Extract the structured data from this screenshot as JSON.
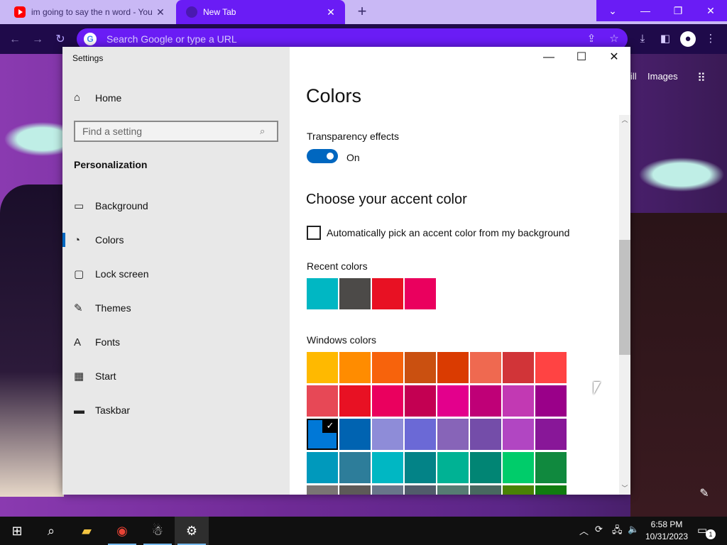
{
  "browser": {
    "tabs": [
      {
        "title": "im going to say the n word - You",
        "close": "✕"
      },
      {
        "title": "New Tab",
        "close": "✕"
      }
    ],
    "new_tab": "+",
    "omnibox_placeholder": "Search Google or type a URL",
    "accent_color": "#6a1cf5"
  },
  "google_links": {
    "gmail_partial": "ill",
    "images": "Images"
  },
  "settings": {
    "window_title": "Settings",
    "home_label": "Home",
    "search_placeholder": "Find a setting",
    "section_title": "Personalization",
    "nav": [
      {
        "label": "Background",
        "icon": "image-icon",
        "glyph": "▭"
      },
      {
        "label": "Colors",
        "icon": "palette-icon",
        "glyph": "◔"
      },
      {
        "label": "Lock screen",
        "icon": "lock-screen-icon",
        "glyph": "▢"
      },
      {
        "label": "Themes",
        "icon": "themes-icon",
        "glyph": "✎"
      },
      {
        "label": "Fonts",
        "icon": "fonts-icon",
        "glyph": "A"
      },
      {
        "label": "Start",
        "icon": "start-icon",
        "glyph": "▦"
      },
      {
        "label": "Taskbar",
        "icon": "taskbar-icon",
        "glyph": "▬"
      }
    ],
    "active_nav": "Colors",
    "page_title": "Colors",
    "transparency_label": "Transparency effects",
    "transparency_state": "On",
    "accent_heading": "Choose your accent color",
    "auto_pick_label": "Automatically pick an accent color from my background",
    "auto_pick_checked": false,
    "recent_colors_label": "Recent colors",
    "recent_colors": [
      "#00b7c3",
      "#4c4a48",
      "#e81123",
      "#ea005e"
    ],
    "windows_colors_label": "Windows colors",
    "windows_colors": [
      [
        "#ffb900",
        "#ff8c00",
        "#f7630c",
        "#ca5010",
        "#da3b01",
        "#ef6950",
        "#d13438",
        "#ff4343"
      ],
      [
        "#e74856",
        "#e81123",
        "#ea005e",
        "#c30052",
        "#e3008c",
        "#bf0077",
        "#c239b3",
        "#9a0089"
      ],
      [
        "#0078d7",
        "#0063b1",
        "#8e8cd8",
        "#6b69d6",
        "#8764b8",
        "#744da9",
        "#b146c2",
        "#881798"
      ],
      [
        "#0099bc",
        "#2d7d9a",
        "#00b7c3",
        "#038387",
        "#00b294",
        "#018574",
        "#00cc6a",
        "#10893e"
      ],
      [
        "#7a7574",
        "#5d5a58",
        "#68768a",
        "#515c6b",
        "#567c73",
        "#486860",
        "#498205",
        "#107c10"
      ]
    ],
    "selected_color": "#0078d7",
    "checkmark": "✓"
  },
  "taskbar": {
    "time": "6:58 PM",
    "date": "10/31/2023",
    "notification_count": "1"
  }
}
